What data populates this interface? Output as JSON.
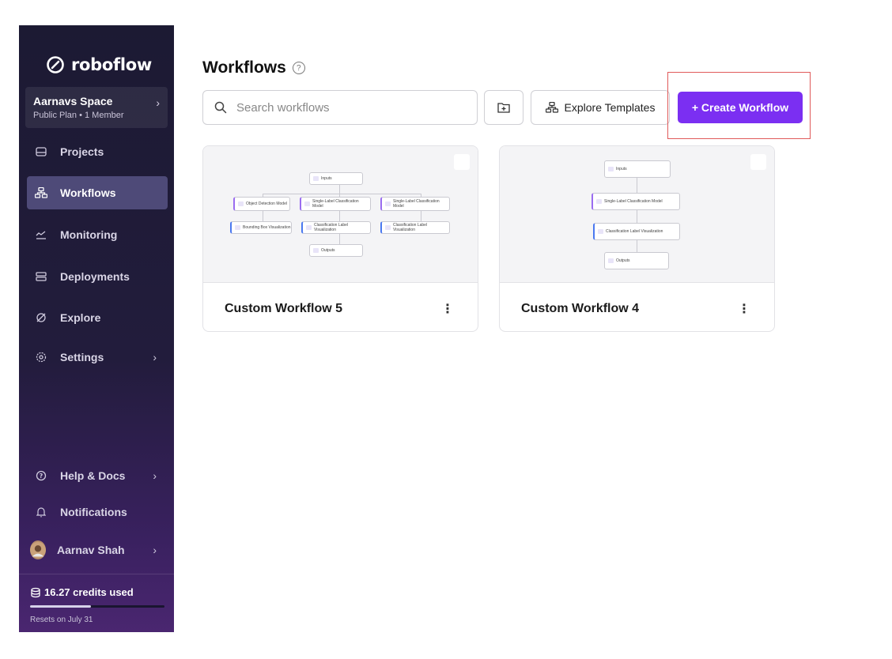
{
  "sidebar": {
    "brand": "roboflow",
    "space": {
      "name": "Aarnavs Space",
      "plan": "Public Plan • 1 Member"
    },
    "items": [
      {
        "label": "Projects",
        "icon": "projects-icon"
      },
      {
        "label": "Workflows",
        "icon": "workflows-icon",
        "active": true
      },
      {
        "label": "Monitoring",
        "icon": "monitoring-icon"
      },
      {
        "label": "Deployments",
        "icon": "deployments-icon"
      },
      {
        "label": "Explore",
        "icon": "explore-icon"
      },
      {
        "label": "Settings",
        "icon": "settings-icon"
      }
    ],
    "bottom": [
      {
        "label": "Help & Docs",
        "icon": "help-icon"
      },
      {
        "label": "Notifications",
        "icon": "bell-icon"
      }
    ],
    "user": {
      "name": "Aarnav Shah"
    },
    "credits": {
      "label": "16.27 credits used",
      "resets": "Resets on July 31",
      "fraction": 0.45
    }
  },
  "header": {
    "title": "Workflows"
  },
  "search": {
    "placeholder": "Search workflows"
  },
  "toolbar": {
    "templates_label": "Explore Templates",
    "create_label": "+ Create Workflow"
  },
  "colors": {
    "accent": "#7b2ff2",
    "sidebar_active": "#4e4a78"
  },
  "workflows": [
    {
      "title": "Custom Workflow 5",
      "preview": {
        "inputs": "Inputs",
        "models": [
          "Object Detection Model",
          "Single-Label Classification Model",
          "Single-Label Classification Model"
        ],
        "visualizations": [
          "Bounding Box Visualization",
          "Classification Label Visualization",
          "Classification Label Visualization"
        ],
        "outputs": "Outputs"
      }
    },
    {
      "title": "Custom Workflow 4",
      "preview": {
        "inputs": "Inputs",
        "models": [
          "Single-Label Classification Model"
        ],
        "visualizations": [
          "Classification Label Visualization"
        ],
        "outputs": "Outputs"
      }
    }
  ]
}
